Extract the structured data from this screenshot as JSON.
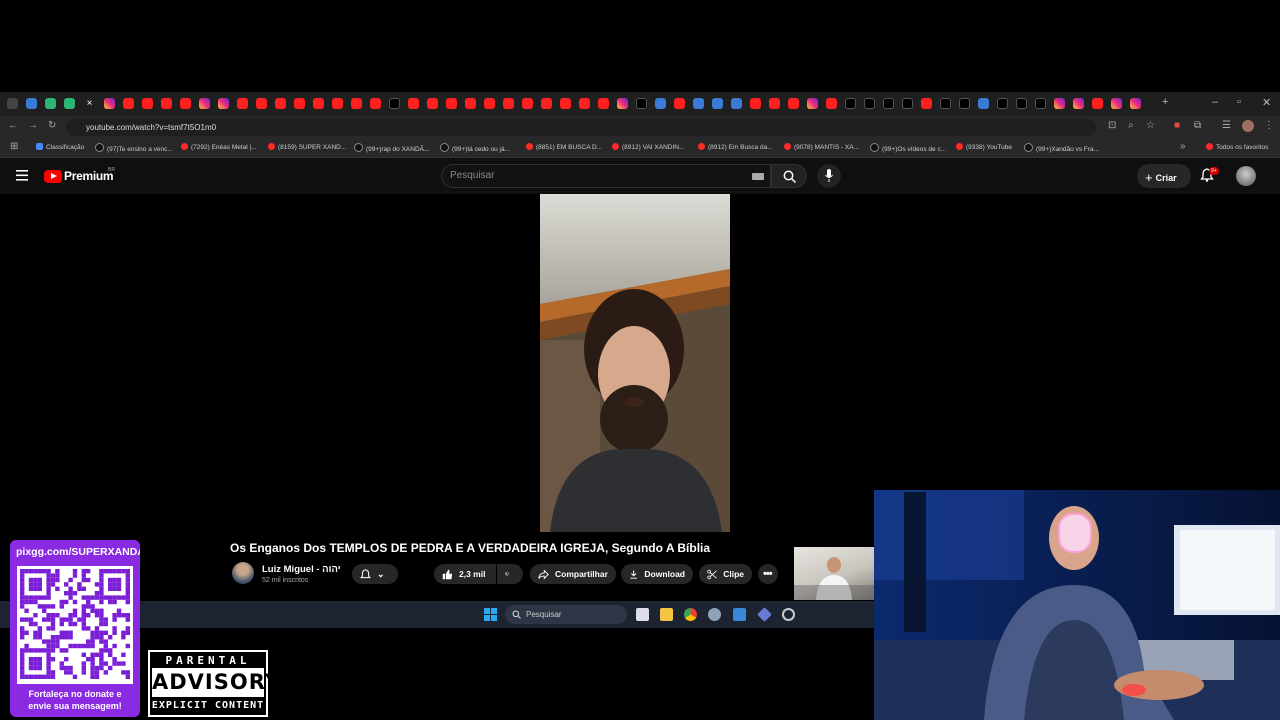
{
  "browser": {
    "url": "youtube.com/watch?v=tsmf7t5O1m0",
    "bookmarks": [
      {
        "label": "Classificação",
        "kind": "cl"
      },
      {
        "label": "(97)Te ensino a venc...",
        "kind": "tt"
      },
      {
        "label": "(7292) Enéas Metal |...",
        "kind": "yt"
      },
      {
        "label": "(8159) SUPER XAND...",
        "kind": "yt"
      },
      {
        "label": "(99+)rap do XANDÃ...",
        "kind": "tt"
      },
      {
        "label": "(99+)tá cedo ou já...",
        "kind": "tt"
      },
      {
        "label": "(8851) EM BUSCA D...",
        "kind": "yt"
      },
      {
        "label": "(8912) VAI XANDIN...",
        "kind": "yt"
      },
      {
        "label": "(8912) Em Busca da...",
        "kind": "yt"
      },
      {
        "label": "(9078) MANTIS - XA...",
        "kind": "yt"
      },
      {
        "label": "(99+)Os vídeos de c...",
        "kind": "tt"
      },
      {
        "label": "(9338) YouTube",
        "kind": "yt"
      },
      {
        "label": "(99+)Xandão vs Fra...",
        "kind": "tt"
      }
    ],
    "all_bookmarks_label": "Todos os favoritos"
  },
  "youtube": {
    "logo_text": "Premium",
    "logo_region": "BR",
    "search_placeholder": "Pesquisar",
    "create_label": "Criar",
    "notif_badge": "9+"
  },
  "video": {
    "title": "Os Enganos Dos TEMPLOS DE PEDRA E A VERDADEIRA IGREJA, Segundo A Bíblia",
    "channel_name": "Luiz Miguel - יהוה",
    "subscribers": "52 mil inscritos",
    "likes": "2,3 mil",
    "share_label": "Compartilhar",
    "download_label": "Download",
    "clip_label": "Clipe"
  },
  "taskbar": {
    "search_label": "Pesquisar"
  },
  "overlay": {
    "qr_url": "pixgg.com/SUPERXANDA",
    "qr_message_1": "Fortaleça no donate e",
    "qr_message_2": "envie sua mensagem!",
    "pa_top": "PARENTAL",
    "pa_mid": "ADVISORY",
    "pa_bot": "EXPLICIT CONTENT"
  },
  "colors": {
    "yt_red": "#ff0000",
    "qr_panel": "#8a2be2",
    "taskbar": "#1c2331"
  }
}
